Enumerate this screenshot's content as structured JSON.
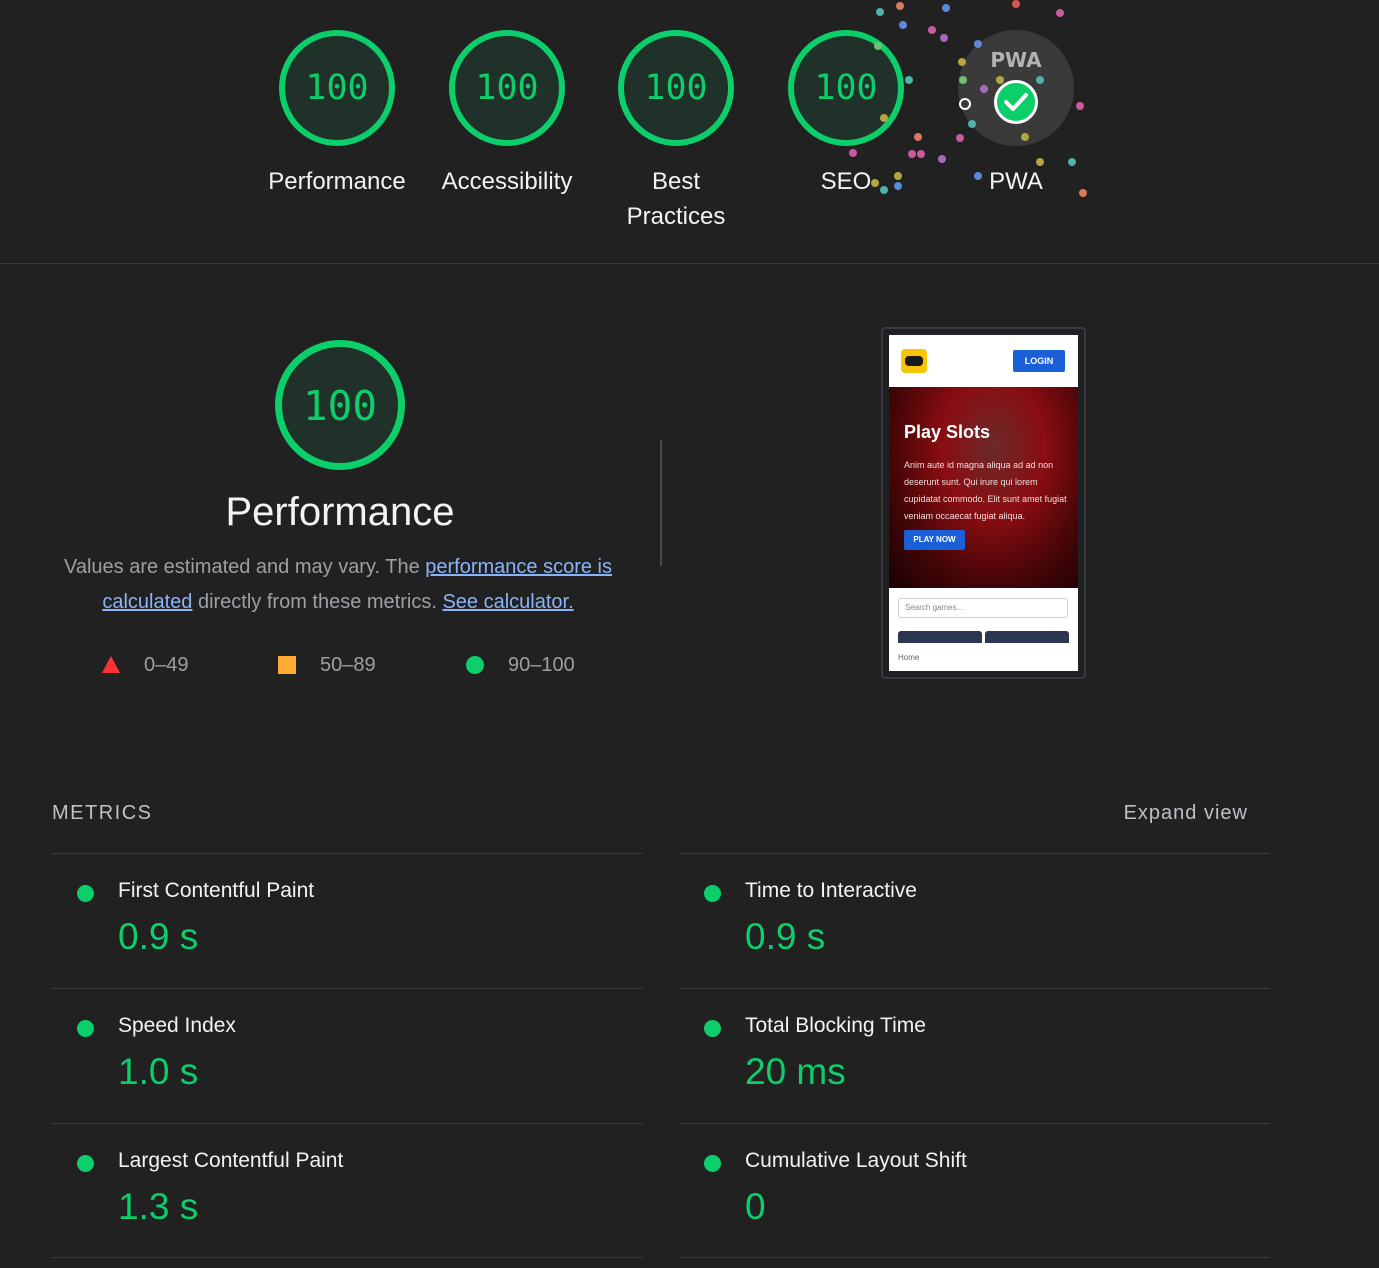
{
  "categories": [
    {
      "score": "100",
      "label": "Performance"
    },
    {
      "score": "100",
      "label": "Accessibility"
    },
    {
      "score": "100",
      "label": "Best Practices"
    },
    {
      "score": "100",
      "label": "SEO"
    }
  ],
  "pwa": {
    "badge_text": "PWA",
    "label": "PWA"
  },
  "performance": {
    "score": "100",
    "title": "Performance",
    "desc_prefix": "Values are estimated and may vary. The ",
    "desc_link": "performance score is calculated",
    "desc_middle": " directly from these metrics. ",
    "desc_link2": "See calculator.",
    "legend": [
      {
        "range": "0–49",
        "color": "#ff3333"
      },
      {
        "range": "50–89",
        "color": "#ffaa33"
      },
      {
        "range": "90–100",
        "color": "#0cce6b"
      }
    ]
  },
  "screenshot": {
    "login": "LOGIN",
    "hero_title": "Play Slots",
    "hero_text": "Anim aute id magna aliqua ad ad non deserunt sunt. Qui irure qui lorem cupidatat commodo. Elit sunt amet fugiat veniam occaecat fugiat aliqua.",
    "play_button": "PLAY NOW",
    "search_placeholder": "Search games...",
    "home": "Home"
  },
  "metrics": {
    "title": "METRICS",
    "expand": "Expand view",
    "items": [
      {
        "name": "First Contentful Paint",
        "value": "0.9 s"
      },
      {
        "name": "Time to Interactive",
        "value": "0.9 s"
      },
      {
        "name": "Speed Index",
        "value": "1.0 s"
      },
      {
        "name": "Total Blocking Time",
        "value": "20 ms"
      },
      {
        "name": "Largest Contentful Paint",
        "value": "1.3 s"
      },
      {
        "name": "Cumulative Layout Shift",
        "value": "0"
      }
    ]
  },
  "colors": {
    "pass": "#0cce6b",
    "link": "#8ab4f8",
    "background": "#212121"
  }
}
